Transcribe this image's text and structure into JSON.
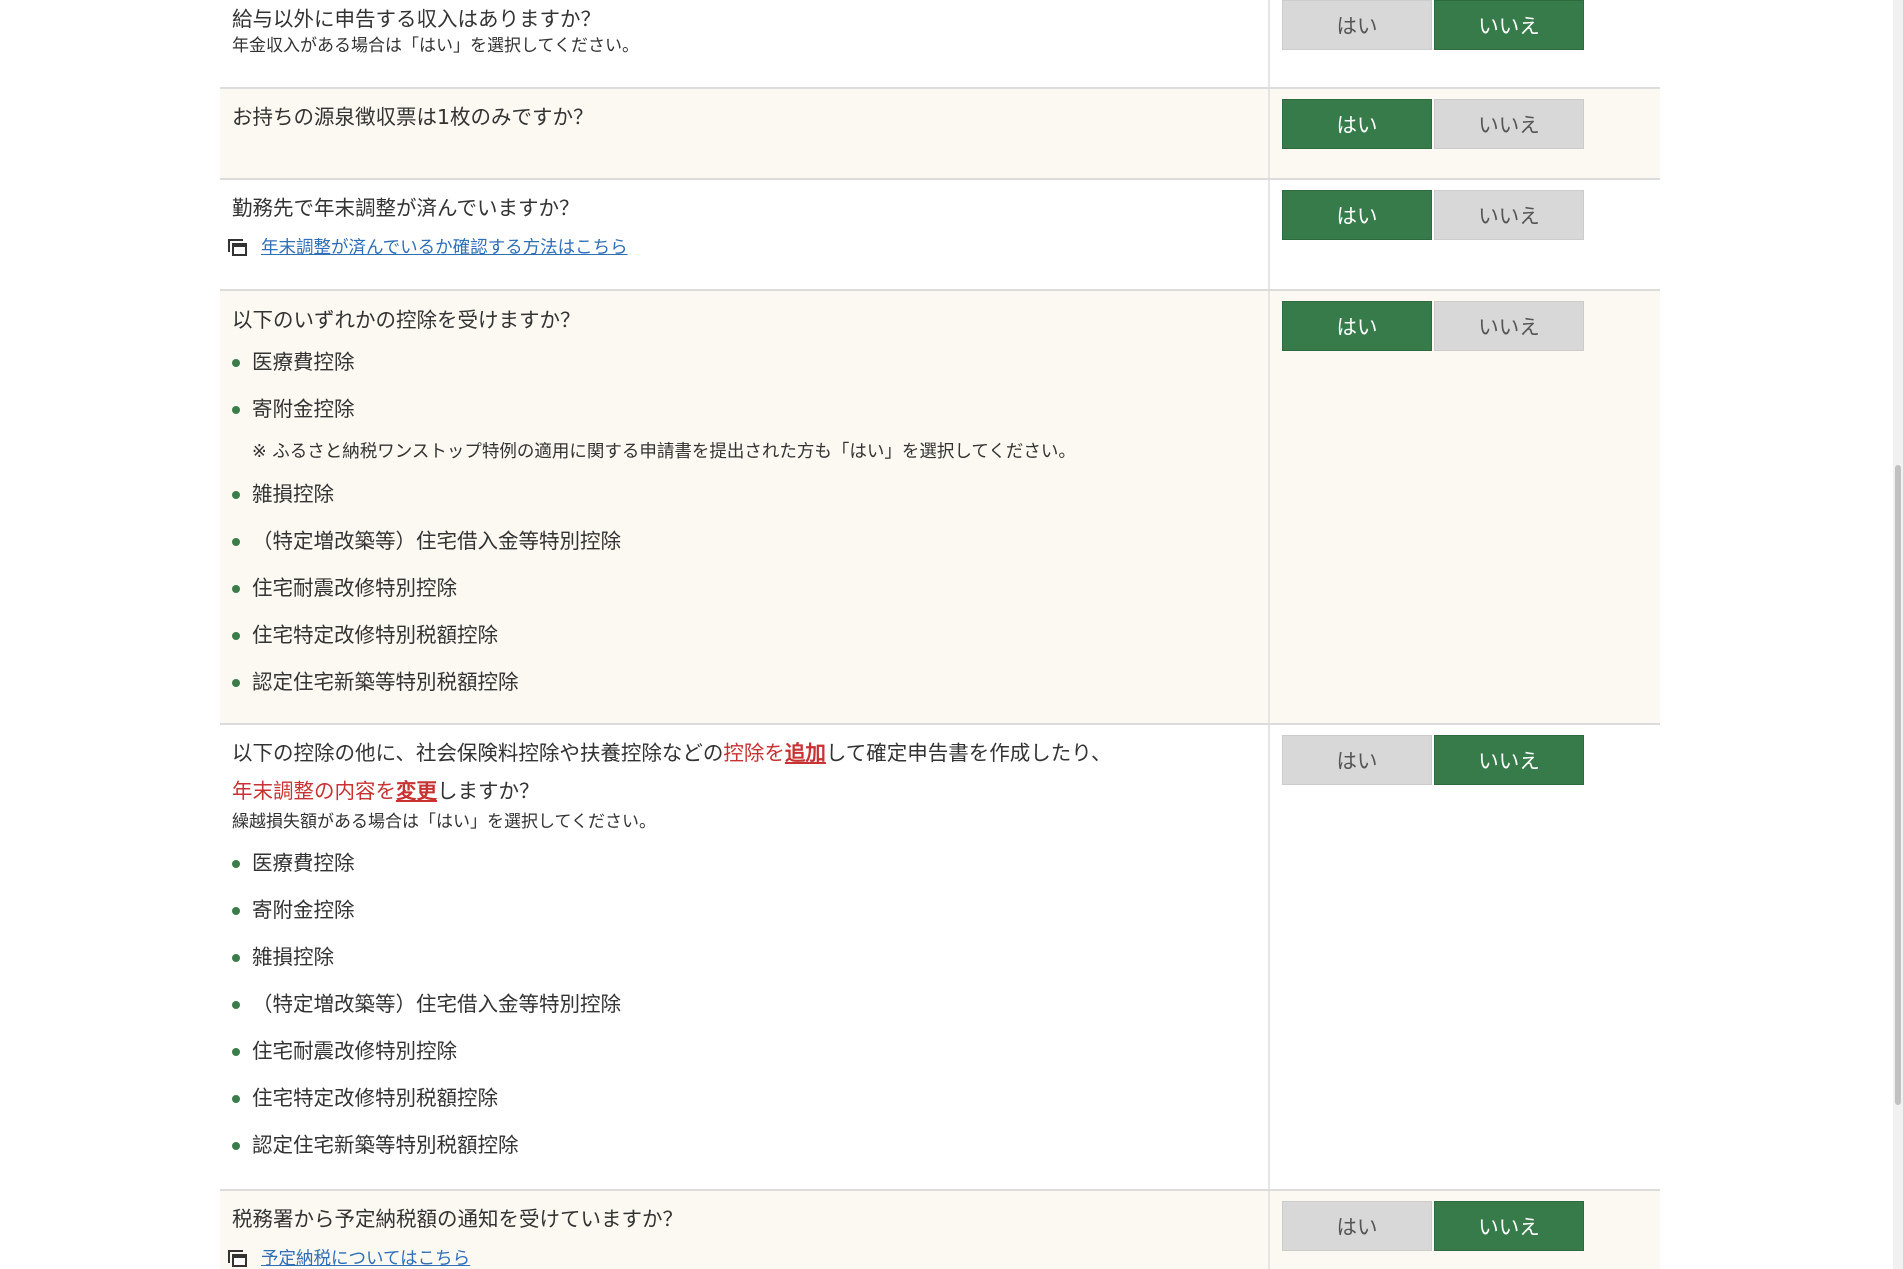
{
  "buttons": {
    "yes": "はい",
    "no": "いいえ"
  },
  "q1": {
    "text": "給与以外に申告する収入はありますか？",
    "note": "年金収入がある場合は「はい」を選択してください。",
    "selected": "no"
  },
  "q2": {
    "text": "お持ちの源泉徴収票は1枚のみですか？",
    "selected": "yes"
  },
  "q3": {
    "text": "勤務先で年末調整が済んでいますか？",
    "link": "年末調整が済んでいるか確認する方法はこちら",
    "selected": "yes"
  },
  "q4": {
    "text": "以下のいずれかの控除を受けますか？",
    "items": [
      "医療費控除",
      "寄附金控除",
      "雑損控除",
      "（特定増改築等）住宅借入金等特別控除",
      "住宅耐震改修特別控除",
      "住宅特定改修特別税額控除",
      "認定住宅新築等特別税額控除"
    ],
    "furusato_note": "※ ふるさと納税ワンストップ特例の適用に関する申請書を提出された方も「はい」を選択してください。",
    "selected": "yes"
  },
  "q5": {
    "line1_a": "以下の控除の他に、社会保険料控除や扶養控除などの",
    "line1_b": "控除を",
    "line1_c": "追加",
    "line1_d": "して確定申告書を作成したり、",
    "line2_a": "年末調整の内容を",
    "line2_b": "変更",
    "line2_c": "しますか？",
    "note": "繰越損失額がある場合は「はい」を選択してください。",
    "items": [
      "医療費控除",
      "寄附金控除",
      "雑損控除",
      "（特定増改築等）住宅借入金等特別控除",
      "住宅耐震改修特別控除",
      "住宅特定改修特別税額控除",
      "認定住宅新築等特別税額控除"
    ],
    "selected": "no"
  },
  "q6": {
    "text": "税務署から予定納税額の通知を受けていますか？",
    "link": "予定納税についてはこちら",
    "selected": "no"
  }
}
